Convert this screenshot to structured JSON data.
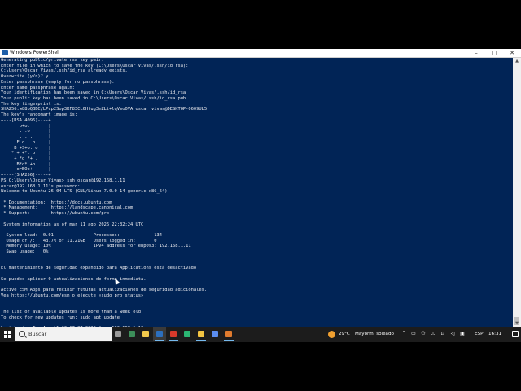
{
  "window": {
    "title": "Windows PowerShell",
    "controls": {
      "minimize": "–",
      "maximize": "□",
      "close": "✕"
    }
  },
  "terminal": {
    "lines": [
      "Generating public/private rsa key pair.",
      "Enter file in which to save the key (C:\\Users\\Oscar Vivas/.ssh/id_rsa):",
      "C:\\Users\\Oscar Vivas/.ssh/id_rsa already exists.",
      "Overwrite (y/n)? y",
      "Enter passphrase (empty for no passphrase):",
      "Enter same passphrase again:",
      "Your identification has been saved in C:\\Users\\Oscar Vivas/.ssh/id_rsa",
      "Your public key has been saved in C:\\Users\\Oscar Vivas/.ssh/id_rsa.pub",
      "The key fingerprint is:",
      "SHA256:w88bQBBC/LPcp2Sop3KF83CL6Htug3mZLt+lqVmoOVA oscar vivas@DESKTOP-0609UL5",
      "The key's randomart image is:",
      "+---[RSA 4096]----+",
      "|      o+o.       |",
      "|      . .o       |",
      "|      . . .      |",
      "|     E o.. o     |",
      "|    B +S+o. o    |",
      "|   * + +*. o     |",
      "|    + *o *+ .    |",
      "|   . B*o*.+o     |",
      "|     o=BOo+      |",
      "+----[SHA256]-----+",
      "PS C:\\Users\\Oscar Vivas> ssh oscar@192.168.1.11",
      "oscar@192.168.1.11's password:",
      "Welcome to Ubuntu 26.04 LTS (GNU/Linux 7.0.0-14-generic x86_64)",
      "",
      " * Documentation:  https://docs.ubuntu.com",
      " * Management:     https://landscape.canonical.com",
      " * Support:        https://ubuntu.com/pro",
      "",
      " System information as of mar 11 ago 2026 22:32:24 UTC",
      "",
      "  System load:  0.01               Processes:             134",
      "  Usage of /:   43.7% of 11.21GB   Users logged in:       0",
      "  Memory usage: 10%                IPv4 address for enp0s3: 192.168.1.11",
      "  Swap usage:   0%",
      "",
      "",
      "El mantenimiento de seguridad expandido para Applications está desactivado",
      "",
      "Se puedes aplicar 0 actualizaciones de forma inmediata.",
      "",
      "Active ESM Apps para recibir futuras actualizaciones de seguridad adicionales.",
      "Vea https://ubuntu.com/esm o ejecute «sudo pro status»",
      "",
      "",
      "The list of available updates is more than a week old.",
      "To check for new updates run: sudo apt update",
      "",
      "Last login: Tue Aug 11 22:17:37 2026 from 192.168.1.10"
    ]
  },
  "taskbar": {
    "search_placeholder": "Buscar",
    "apps": [
      {
        "icon": "task-view-icon",
        "color": "#9a9a9a"
      },
      {
        "icon": "terminal-icon",
        "color": "#3d8f5a"
      },
      {
        "icon": "notes-icon",
        "color": "#f2c94c"
      },
      {
        "icon": "powershell-icon",
        "color": "#2c6fbe"
      },
      {
        "icon": "chrome-icon",
        "color": "#d93a2b"
      },
      {
        "icon": "edge-icon",
        "color": "#2bb673"
      },
      {
        "icon": "file-explorer-icon",
        "color": "#f4c542"
      },
      {
        "icon": "store-icon",
        "color": "#5b8def"
      },
      {
        "icon": "media-icon",
        "color": "#e07b2e"
      }
    ],
    "weather_temp": "29°C",
    "weather_desc": "Mayorm. soleado",
    "language": "ESP",
    "time": "16:31"
  }
}
